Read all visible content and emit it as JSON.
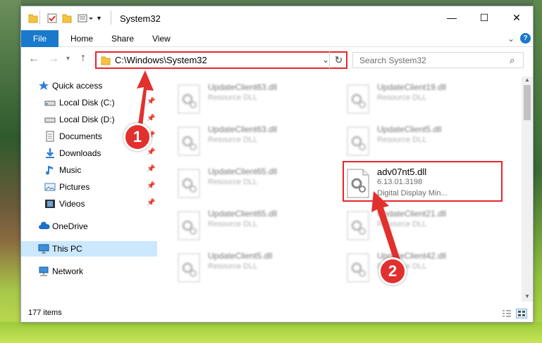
{
  "window": {
    "title": "System32",
    "controls": {
      "minimize": "—",
      "maximize": "☐",
      "close": "✕"
    }
  },
  "ribbon": {
    "file": "File",
    "tabs": [
      "Home",
      "Share",
      "View"
    ],
    "help": "?"
  },
  "address": {
    "path": "C:\\Windows\\System32",
    "search_placeholder": "Search System32"
  },
  "sidebar": {
    "items": [
      {
        "label": "Quick access",
        "icon": "star-icon"
      },
      {
        "label": "Local Disk (C:)",
        "icon": "drive-icon",
        "pinned": true
      },
      {
        "label": "Local Disk (D:)",
        "icon": "drive-icon",
        "pinned": true
      },
      {
        "label": "Documents",
        "icon": "documents-icon",
        "pinned": true
      },
      {
        "label": "Downloads",
        "icon": "download-icon",
        "pinned": true
      },
      {
        "label": "Music",
        "icon": "music-icon",
        "pinned": true
      },
      {
        "label": "Pictures",
        "icon": "pictures-icon",
        "pinned": true
      },
      {
        "label": "Videos",
        "icon": "videos-icon",
        "pinned": true
      },
      {
        "label": "OneDrive",
        "icon": "cloud-icon"
      },
      {
        "label": "This PC",
        "icon": "pc-icon",
        "selected": true
      },
      {
        "label": "Network",
        "icon": "network-icon"
      }
    ]
  },
  "files": [
    {
      "name": "UpdateClient63.dll",
      "type": "Resource DLL"
    },
    {
      "name": "UpdateClient19.dll",
      "type": "Resource DLL"
    },
    {
      "name": "UpdateClient63.dll",
      "type": "Resource DLL"
    },
    {
      "name": "UpdateClient5.dll",
      "type": "Resource DLL"
    },
    {
      "name": "UpdateClient65.dll",
      "type": "Resource DLL"
    },
    {
      "name": "adv07nt5.dll",
      "version": "6.13.01.3198",
      "type": "Digital Display Min...",
      "highlighted": true
    },
    {
      "name": "UpdateClient65.dll",
      "type": "Resource DLL"
    },
    {
      "name": "UpdateClient21.dll",
      "type": "Resource DLL"
    },
    {
      "name": "UpdateClient5.dll",
      "type": "Resource DLL"
    },
    {
      "name": "UpdateClient42.dll",
      "type": "Resource DLL"
    }
  ],
  "status": {
    "item_count": "177 items"
  },
  "markers": {
    "m1": "1",
    "m2": "2"
  },
  "colors": {
    "accent": "#1979ca",
    "highlight": "#e8262b",
    "selection": "#cce8ff"
  }
}
